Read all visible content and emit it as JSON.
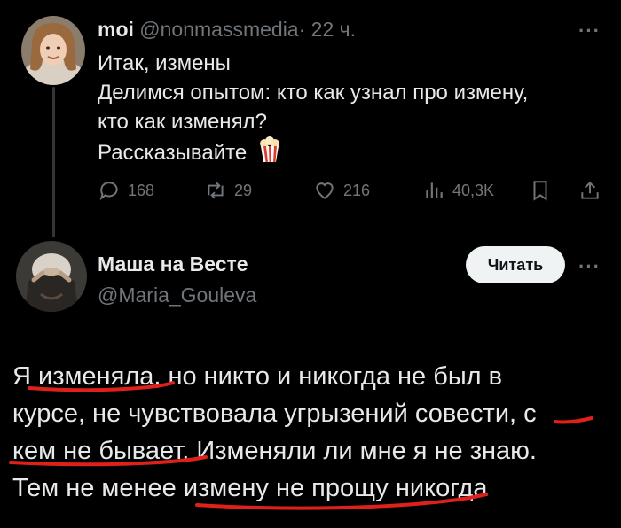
{
  "post1": {
    "author_name": "moi",
    "handle": "@nonmassmedia",
    "separator": "·",
    "time": "22 ч.",
    "lines": [
      "Итак, измены",
      "Делимся опытом: кто как узнал про измену,",
      "кто как изменял?",
      "Рассказывайте"
    ],
    "emoji": "popcorn",
    "actions": {
      "replies": "168",
      "reposts": "29",
      "likes": "216",
      "views": "40,3K"
    }
  },
  "post2": {
    "author_name": "Маша на Весте",
    "handle": "@Maria_Gouleva",
    "follow_label": "Читать",
    "body_segments": [
      "Я ",
      "изменяла",
      ", но никто и никогда не был в",
      "курсе, не чувствовала угрызений совести, ",
      "с",
      "кем не бывает",
      ". Изменяли ли мне я не знаю.",
      "Тем не менее ",
      "измену не прощу никогда"
    ]
  },
  "ui": {
    "more_dots": "···",
    "accent_annotation_color": "#e0201b",
    "action_color": "#71767b"
  }
}
